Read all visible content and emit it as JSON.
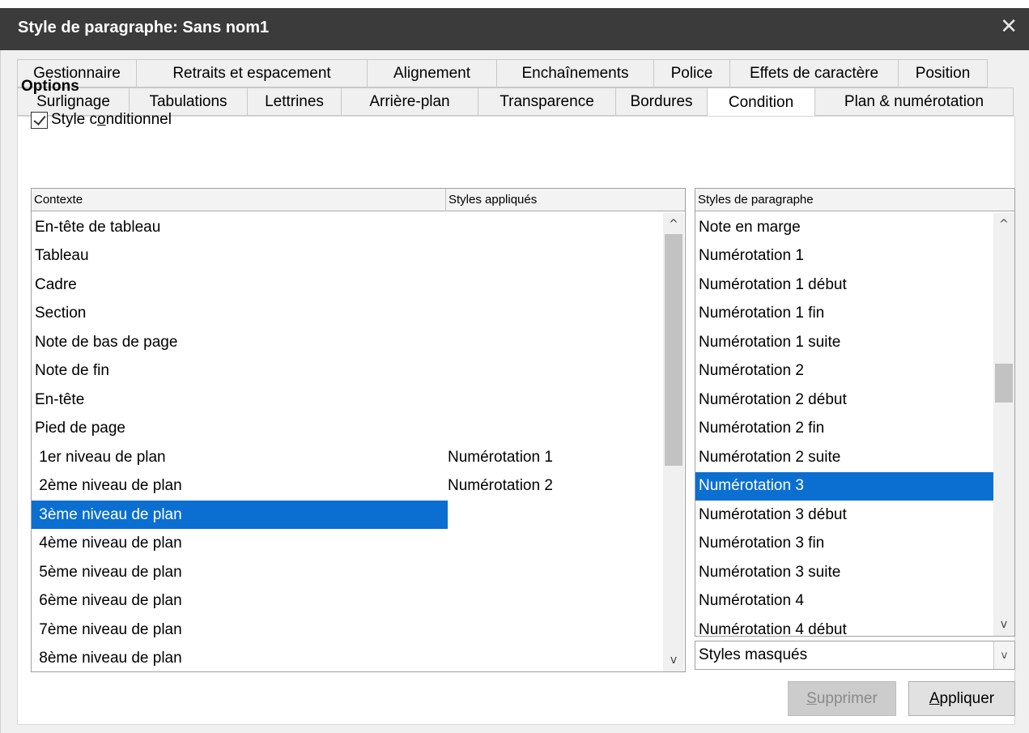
{
  "window": {
    "title": "Style de paragraphe: Sans nom1",
    "close_glyph": "✕"
  },
  "tabs": {
    "row1": [
      "Gestionnaire",
      "Retraits et espacement",
      "Alignement",
      "Enchaînements",
      "Police",
      "Effets de caractère",
      "Position"
    ],
    "row2": [
      "Surlignage",
      "Tabulations",
      "Lettrines",
      "Arrière-plan",
      "Transparence",
      "Bordures",
      "Condition",
      "Plan & numérotation"
    ],
    "active": "Condition"
  },
  "options": {
    "title": "Options",
    "conditional_style": {
      "label_before": "Style c",
      "label_mnemonic": "o",
      "label_after": "nditionnel",
      "checked": true
    }
  },
  "context_table": {
    "headers": [
      "Contexte",
      "Styles appliqués"
    ],
    "rows": [
      {
        "context": "En-tête de tableau",
        "style": ""
      },
      {
        "context": "Tableau",
        "style": ""
      },
      {
        "context": "Cadre",
        "style": ""
      },
      {
        "context": "Section",
        "style": ""
      },
      {
        "context": "Note de bas de page",
        "style": ""
      },
      {
        "context": "Note de fin",
        "style": ""
      },
      {
        "context": "En-tête",
        "style": ""
      },
      {
        "context": "Pied de page",
        "style": ""
      },
      {
        "context": " 1er niveau de plan",
        "style": "Numérotation 1"
      },
      {
        "context": " 2ème niveau de plan",
        "style": "Numérotation 2"
      },
      {
        "context": " 3ème niveau de plan",
        "style": ""
      },
      {
        "context": " 4ème niveau de plan",
        "style": ""
      },
      {
        "context": " 5ème niveau de plan",
        "style": ""
      },
      {
        "context": " 6ème niveau de plan",
        "style": ""
      },
      {
        "context": " 7ème niveau de plan",
        "style": ""
      },
      {
        "context": " 8ème niveau de plan",
        "style": ""
      }
    ],
    "selected_index": 10
  },
  "paragraph_styles": {
    "header": "Styles de paragraphe",
    "items": [
      "Note en marge",
      "Numérotation 1",
      "Numérotation 1 début",
      "Numérotation 1 fin",
      "Numérotation 1 suite",
      "Numérotation 2",
      "Numérotation 2 début",
      "Numérotation 2 fin",
      "Numérotation 2 suite",
      "Numérotation 3",
      "Numérotation 3 début",
      "Numérotation 3 fin",
      "Numérotation 3 suite",
      "Numérotation 4",
      "Numérotation 4 début"
    ],
    "selected_index": 9
  },
  "filter": {
    "value": "Styles masqués"
  },
  "buttons": {
    "remove": {
      "mnemonic": "S",
      "rest": "upprimer",
      "enabled": false
    },
    "apply": {
      "mnemonic": "A",
      "rest": "ppliquer",
      "enabled": true
    }
  },
  "icons": {
    "scroll_up": "^",
    "scroll_down": "v",
    "combo_arrow": "v"
  }
}
